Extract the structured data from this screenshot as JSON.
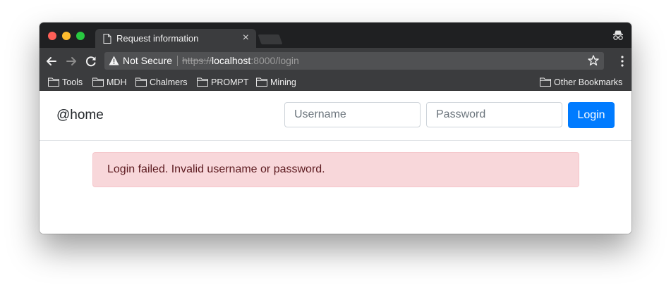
{
  "browser": {
    "tab": {
      "title": "Request information",
      "close_glyph": "×",
      "icon": "document-icon"
    },
    "toolbar": {
      "security_label": "Not Secure",
      "url_scheme": "https://",
      "url_host": "localhost",
      "url_rest": ":8000/login"
    },
    "bookmarks": [
      {
        "label": "Tools",
        "icon": "folder-icon"
      },
      {
        "label": "MDH",
        "icon": "folder-icon"
      },
      {
        "label": "Chalmers",
        "icon": "folder-icon"
      },
      {
        "label": "PROMPT",
        "icon": "folder-icon"
      },
      {
        "label": "Mining",
        "icon": "folder-icon"
      }
    ],
    "other_bookmarks": {
      "label": "Other Bookmarks",
      "icon": "folder-icon"
    }
  },
  "page": {
    "brand": "@home",
    "login_form": {
      "username_placeholder": "Username",
      "username_value": "",
      "password_placeholder": "Password",
      "password_value": "",
      "submit_label": "Login"
    },
    "alert": {
      "message": "Login failed. Invalid username or password."
    }
  },
  "colors": {
    "primary": "#007bff",
    "alert_bg": "#f8d7da",
    "alert_text": "#721c24",
    "chrome_dark": "#1f2022",
    "chrome_toolbar": "#3b3c3e"
  }
}
